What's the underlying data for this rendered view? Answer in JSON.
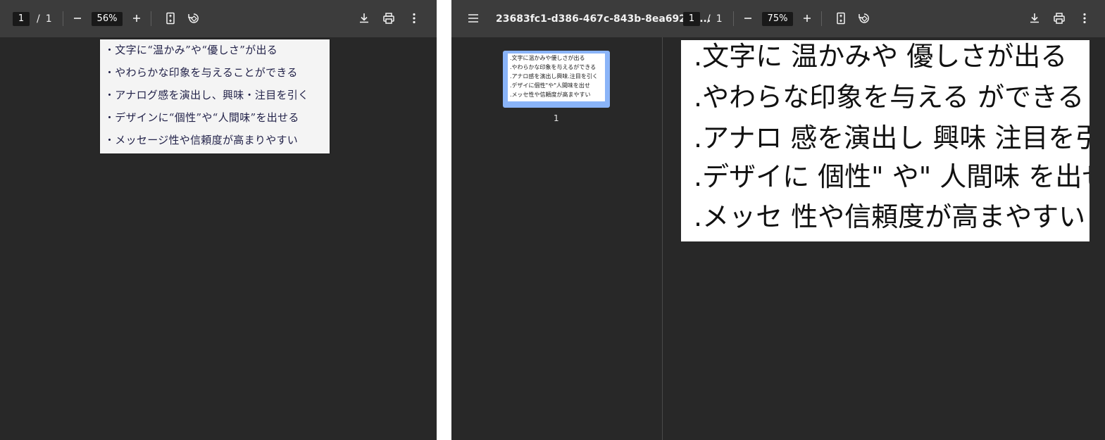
{
  "left": {
    "toolbar": {
      "page_current": "1",
      "page_separator": "/",
      "page_total": "1",
      "zoom": "56%"
    },
    "page_lines": [
      "・文字に“温かみ”や“優しさ”が出る",
      "・やわらかな印象を与えることができる",
      "・アナログ感を演出し、興味・注目を引く",
      "・デザインに“個性”や“人間味”を出せる",
      "・メッセージ性や信頼度が高まりやすい"
    ]
  },
  "right": {
    "toolbar": {
      "title": "23683fc1-d386-467c-843b-8ea6927e...",
      "page_current": "1",
      "page_separator": "/",
      "page_total": "1",
      "zoom": "75%"
    },
    "thumbnail_label": "1",
    "thumb_lines": [
      ".文字に温かみや優しさが出る",
      ".やわらかな印象を与えるができる",
      ".アナロ感を演出し興味.注目を引く",
      ".デザイに個性\"や\"人間味を出せ",
      ".メッセ性や信頼度が高まやすい"
    ],
    "page_lines": [
      ".文字に 温かみや 優しさが出る",
      ".やわらな印象を与える ができる",
      ".アナロ 感を演出し 興味 注目を引く",
      ".デザイに 個性\" や\" 人間味 を出せ",
      ".メッセ 性や信頼度が高まやすい"
    ]
  },
  "icons": {
    "zoom_out": "minus-icon",
    "zoom_in": "plus-icon",
    "fit": "fit-page-icon",
    "rotate": "rotate-icon",
    "download": "download-icon",
    "print": "print-icon",
    "more": "more-vert-icon",
    "menu": "menu-icon"
  },
  "colors": {
    "toolbar": "#3c3c3c",
    "viewer_bg": "#282828",
    "thumb_highlight": "#8ab4f8",
    "handwriting": "#23234a"
  }
}
